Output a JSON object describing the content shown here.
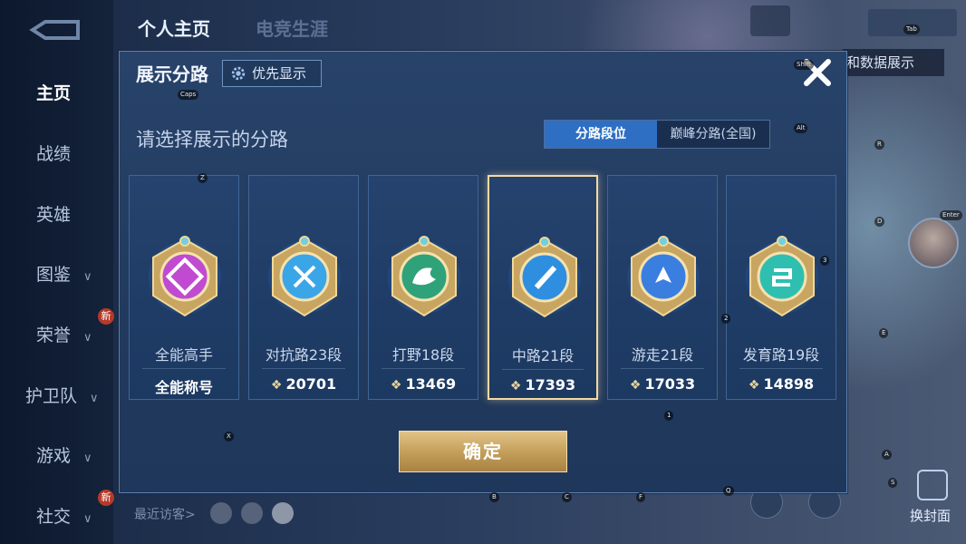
{
  "top_tabs": [
    "个人主页",
    "电竞生涯"
  ],
  "left_nav": [
    {
      "label": "主页",
      "active": true,
      "chevron": false
    },
    {
      "label": "战绩",
      "active": false,
      "chevron": false
    },
    {
      "label": "英雄",
      "active": false,
      "chevron": false
    },
    {
      "label": "图鉴",
      "active": false,
      "chevron": true
    },
    {
      "label": "荣誉",
      "active": false,
      "chevron": true
    },
    {
      "label": "护卫队",
      "active": false,
      "chevron": true
    },
    {
      "label": "游戏",
      "active": false,
      "chevron": true
    },
    {
      "label": "社交",
      "active": false,
      "chevron": true
    }
  ],
  "new_badge": "新",
  "right_tab": "和数据展示",
  "bottom": {
    "recent_visitors": "最近访客>",
    "switch_cover": "换封面"
  },
  "dialog": {
    "title": "展示分路",
    "priority_label": "优先显示",
    "subtitle": "请选择展示的分路",
    "segment": {
      "active": "分路段位",
      "inactive": "巅峰分路(全国)"
    },
    "confirm": "确定",
    "cards": [
      {
        "name": "全能高手",
        "score": "全能称号",
        "has_icon": false,
        "selected": false,
        "emblem": "all-round-emblem-icon",
        "color": "#c04bd0"
      },
      {
        "name": "对抗路23段",
        "score": "20701",
        "has_icon": true,
        "selected": false,
        "emblem": "clash-lane-emblem-icon",
        "color": "#3aa6e8"
      },
      {
        "name": "打野18段",
        "score": "13469",
        "has_icon": true,
        "selected": false,
        "emblem": "jungle-emblem-icon",
        "color": "#2fa27a"
      },
      {
        "name": "中路21段",
        "score": "17393",
        "has_icon": true,
        "selected": true,
        "emblem": "mid-lane-emblem-icon",
        "color": "#2e8fe0"
      },
      {
        "name": "游走21段",
        "score": "17033",
        "has_icon": true,
        "selected": false,
        "emblem": "roam-emblem-icon",
        "color": "#3a7fe0"
      },
      {
        "name": "发育路19段",
        "score": "14898",
        "has_icon": true,
        "selected": false,
        "emblem": "farm-lane-emblem-icon",
        "color": "#2fbfb0"
      }
    ]
  },
  "key_hints": [
    "Tab",
    "Shift",
    "Caps",
    "Alt",
    "R",
    "Z",
    "D",
    "Enter",
    "3",
    "2",
    "E",
    "1",
    "X",
    "A",
    "S",
    "B",
    "C",
    "F",
    "Q"
  ]
}
